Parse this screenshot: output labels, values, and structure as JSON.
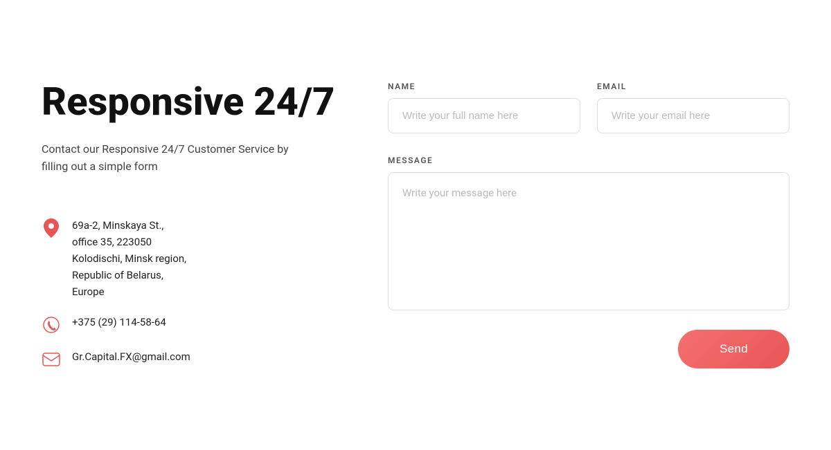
{
  "page": {
    "title": "Responsive 24/7",
    "subtitle": "Contact our Responsive 24/7 Customer Service by filling out a simple form"
  },
  "contact": {
    "address_line1": "69a-2, Minskaya St.,",
    "address_line2": "office 35, 223050",
    "address_line3": "Kolodischi, Minsk region,",
    "address_line4": "Republic of Belarus,",
    "address_line5": "Europe",
    "phone": "+375 (29) 114-58-64",
    "email": "Gr.Capital.FX@gmail.com"
  },
  "form": {
    "name_label": "NAME",
    "name_placeholder": "Write your full name here",
    "email_label": "EMAIL",
    "email_placeholder": "Write your email here",
    "message_label": "MESSAGE",
    "message_placeholder": "Write your message here",
    "send_button": "Send"
  },
  "icons": {
    "pin": "📍",
    "phone": "📞",
    "email": "✉️"
  }
}
